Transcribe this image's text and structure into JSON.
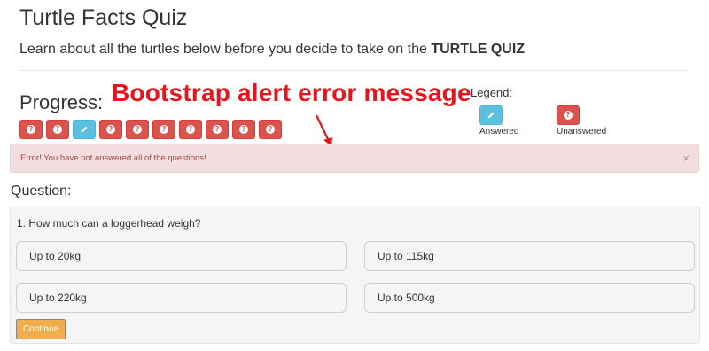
{
  "header": {
    "title": "Turtle Facts Quiz",
    "subtitle_text": "Learn about all the turtles below before you decide to take on the ",
    "subtitle_bold": "TURTLE QUIZ"
  },
  "annotation": {
    "text": "Bootstrap alert error message",
    "color": "#e8141b"
  },
  "progress": {
    "label": "Progress:",
    "buttons": [
      {
        "state": "unanswered",
        "icon": "question-circle-icon"
      },
      {
        "state": "unanswered",
        "icon": "question-circle-icon"
      },
      {
        "state": "answered",
        "icon": "pencil-icon"
      },
      {
        "state": "unanswered",
        "icon": "question-circle-icon"
      },
      {
        "state": "unanswered",
        "icon": "question-circle-icon"
      },
      {
        "state": "unanswered",
        "icon": "question-circle-icon"
      },
      {
        "state": "unanswered",
        "icon": "question-circle-icon"
      },
      {
        "state": "unanswered",
        "icon": "question-circle-icon"
      },
      {
        "state": "unanswered",
        "icon": "question-circle-icon"
      },
      {
        "state": "unanswered",
        "icon": "question-circle-icon"
      }
    ]
  },
  "legend": {
    "label": "Legend:",
    "answered": "Answered",
    "unanswered": "Unanswered"
  },
  "alert": {
    "message": "Error! You have not answered all of the questions!",
    "close": "×"
  },
  "question": {
    "heading": "Question:",
    "text": "1. How much can a loggerhead weigh?",
    "answers": [
      "Up to 20kg",
      "Up to 115kg",
      "Up to 220kg",
      "Up to 500kg"
    ],
    "continue_label": "Continue"
  },
  "colors": {
    "danger": "#d9534f",
    "info": "#5bc0de",
    "warning": "#f0ad4e",
    "alert_bg": "#f2dede",
    "alert_text": "#a94442"
  }
}
